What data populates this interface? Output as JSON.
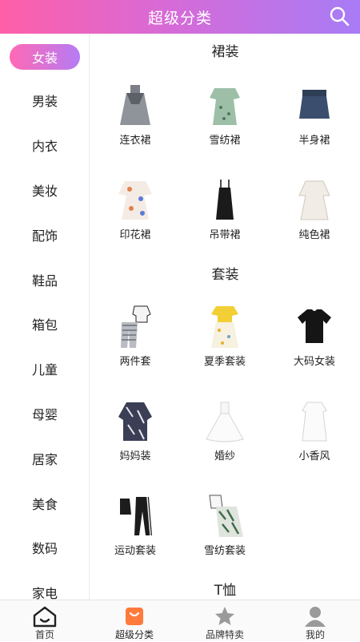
{
  "header": {
    "title": "超级分类"
  },
  "sidebar": {
    "active_index": 0,
    "items": [
      {
        "label": "女装"
      },
      {
        "label": "男装"
      },
      {
        "label": "内衣"
      },
      {
        "label": "美妆"
      },
      {
        "label": "配饰"
      },
      {
        "label": "鞋品"
      },
      {
        "label": "箱包"
      },
      {
        "label": "儿童"
      },
      {
        "label": "母婴"
      },
      {
        "label": "居家"
      },
      {
        "label": "美食"
      },
      {
        "label": "数码"
      },
      {
        "label": "家电"
      }
    ]
  },
  "sections": [
    {
      "title": "裙装",
      "items": [
        {
          "label": "连衣裙",
          "icon": "dress-icon"
        },
        {
          "label": "雪纺裙",
          "icon": "dress-icon"
        },
        {
          "label": "半身裙",
          "icon": "skirt-icon"
        },
        {
          "label": "印花裙",
          "icon": "dress-icon"
        },
        {
          "label": "吊带裙",
          "icon": "dress-icon"
        },
        {
          "label": "纯色裙",
          "icon": "dress-icon"
        }
      ]
    },
    {
      "title": "套装",
      "items": [
        {
          "label": "两件套",
          "icon": "outfit-icon"
        },
        {
          "label": "夏季套装",
          "icon": "outfit-icon"
        },
        {
          "label": "大码女装",
          "icon": "tshirt-icon"
        },
        {
          "label": "妈妈装",
          "icon": "outfit-icon"
        },
        {
          "label": "婚纱",
          "icon": "gown-icon"
        },
        {
          "label": "小香风",
          "icon": "dress-icon"
        },
        {
          "label": "运动套装",
          "icon": "outfit-icon"
        },
        {
          "label": "雪纺套装",
          "icon": "outfit-icon"
        }
      ]
    },
    {
      "title": "T恤",
      "items": []
    }
  ],
  "bottom_nav": {
    "active_index": 1,
    "items": [
      {
        "label": "首页",
        "icon": "home-icon"
      },
      {
        "label": "超级分类",
        "icon": "category-icon"
      },
      {
        "label": "品牌特卖",
        "icon": "star-icon"
      },
      {
        "label": "我的",
        "icon": "profile-icon"
      }
    ]
  },
  "colors": {
    "accent_start": "#ff5fa8",
    "accent_end": "#a77cf6",
    "category_icon": "#ff7a3d"
  }
}
